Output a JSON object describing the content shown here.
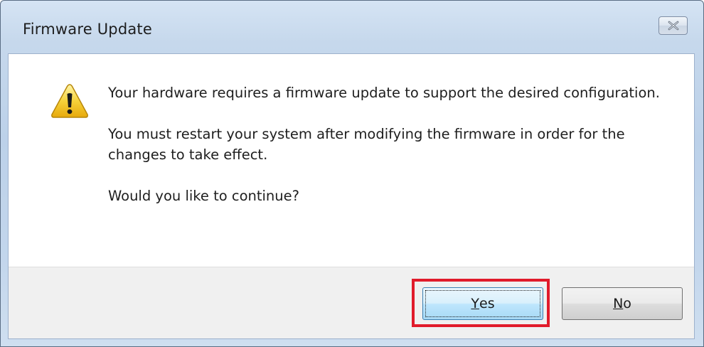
{
  "window": {
    "title": "Firmware Update",
    "close_icon": "close-icon"
  },
  "dialog": {
    "icon": "warning-icon",
    "messages": [
      "Your hardware requires a firmware update to support the desired configuration.",
      "You must restart your system after modifying the firmware in order for the changes to take effect.",
      "Would you like to continue?"
    ]
  },
  "buttons": {
    "yes": {
      "mnemonic": "Y",
      "rest": "es"
    },
    "no": {
      "mnemonic": "N",
      "rest": "o"
    }
  },
  "colors": {
    "highlight": "#e11b2b",
    "warning_yellow": "#f5c400"
  }
}
